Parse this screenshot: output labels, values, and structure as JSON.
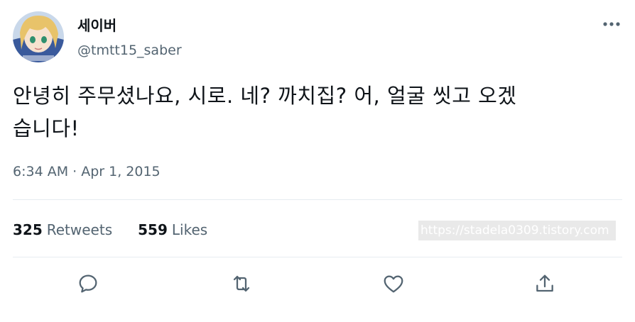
{
  "user": {
    "display_name": "세이버",
    "handle": "@tmtt15_saber",
    "avatar_icon": "anime-avatar"
  },
  "tweet": {
    "text_line1": "안녕히 주무셨나요, 시로. 네? 까치집? 어, 얼굴 씻고 오겠",
    "text_line2": "습니다!",
    "timestamp": "6:34 AM · Apr 1, 2015"
  },
  "stats": {
    "retweets_count": "325",
    "retweets_label": "Retweets",
    "likes_count": "559",
    "likes_label": "Likes"
  },
  "watermark": "https://stadela0309.tistory.com",
  "actions": {
    "reply_icon": "reply-icon",
    "retweet_icon": "retweet-icon",
    "like_icon": "heart-icon",
    "share_icon": "share-icon"
  },
  "colors": {
    "text_primary": "#0f1419",
    "text_secondary": "#536471",
    "divider": "#e6ecf0"
  }
}
